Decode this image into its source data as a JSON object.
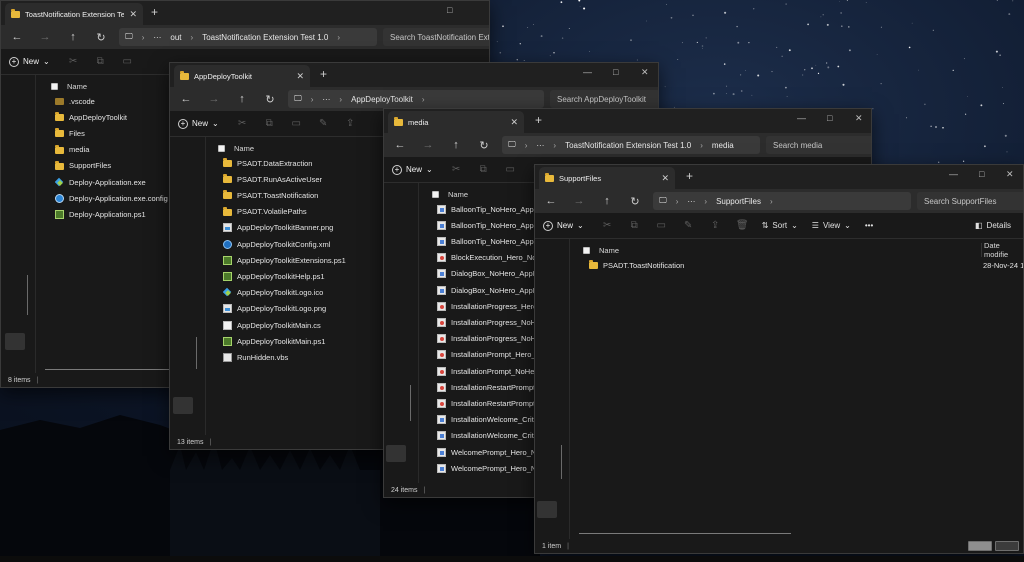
{
  "windows": {
    "w1": {
      "tab_title": "ToastNotification Extension Te",
      "breadcrumb": [
        "out",
        "ToastNotification Extension Test 1.0"
      ],
      "search_placeholder": "Search ToastNotification Ext",
      "new_label": "New",
      "column_name": "Name",
      "items": [
        {
          "name": ".vscode",
          "icon": "vscode-folder-icon"
        },
        {
          "name": "AppDeployToolkit",
          "icon": "folder-icon"
        },
        {
          "name": "Files",
          "icon": "folder-icon"
        },
        {
          "name": "media",
          "icon": "folder-icon"
        },
        {
          "name": "SupportFiles",
          "icon": "folder-icon"
        },
        {
          "name": "Deploy-Application.exe",
          "icon": "exe-icon"
        },
        {
          "name": "Deploy-Application.exe.config",
          "icon": "config-icon"
        },
        {
          "name": "Deploy-Application.ps1",
          "icon": "powershell-script-icon"
        }
      ],
      "status_text": "8 items"
    },
    "w2": {
      "tab_title": "AppDeployToolkit",
      "breadcrumb": [
        "AppDeployToolkit"
      ],
      "search_placeholder": "Search AppDeployToolkit",
      "new_label": "New",
      "column_name": "Name",
      "items": [
        {
          "name": "PSADT.DataExtraction",
          "icon": "folder-icon"
        },
        {
          "name": "PSADT.RunAsActiveUser",
          "icon": "folder-icon"
        },
        {
          "name": "PSADT.ToastNotification",
          "icon": "folder-icon"
        },
        {
          "name": "PSADT.VolatilePaths",
          "icon": "folder-icon"
        },
        {
          "name": "AppDeployToolkitBanner.png",
          "icon": "png-image-icon"
        },
        {
          "name": "AppDeployToolkitConfig.xml",
          "icon": "xml-file-icon"
        },
        {
          "name": "AppDeployToolkitExtensions.ps1",
          "icon": "powershell-script-icon"
        },
        {
          "name": "AppDeployToolkitHelp.ps1",
          "icon": "powershell-script-icon"
        },
        {
          "name": "AppDeployToolkitLogo.ico",
          "icon": "ico-file-icon"
        },
        {
          "name": "AppDeployToolkitLogo.png",
          "icon": "png-image-icon"
        },
        {
          "name": "AppDeployToolkitMain.cs",
          "icon": "csharp-file-icon"
        },
        {
          "name": "AppDeployToolkitMain.ps1",
          "icon": "powershell-script-icon"
        },
        {
          "name": "RunHidden.vbs",
          "icon": "vbs-script-icon"
        }
      ],
      "status_text": "13 items"
    },
    "w3": {
      "tab_title": "media",
      "breadcrumb": [
        "ToastNotification Extension Test 1.0",
        "media"
      ],
      "search_placeholder": "Search media",
      "new_label": "New",
      "column_name": "Name",
      "items": [
        {
          "name": "BalloonTip_NoHero_AppLog",
          "icon": "image-file-icon"
        },
        {
          "name": "BalloonTip_NoHero_AppLog",
          "icon": "image-file-icon"
        },
        {
          "name": "BalloonTip_NoHero_AppLog",
          "icon": "image-file-icon"
        },
        {
          "name": "BlockExecution_Hero_NoAp",
          "icon": "image-file-red-icon"
        },
        {
          "name": "DialogBox_NoHero_AppLog",
          "icon": "image-file-icon"
        },
        {
          "name": "DialogBox_NoHero_AppLog",
          "icon": "image-file-icon"
        },
        {
          "name": "InstallationProgress_Hero_Ap",
          "icon": "image-file-red-icon"
        },
        {
          "name": "InstallationProgress_NoHero",
          "icon": "image-file-red-icon"
        },
        {
          "name": "InstallationProgress_NoHero",
          "icon": "image-file-red-icon"
        },
        {
          "name": "InstallationPrompt_Hero_Ap",
          "icon": "image-file-red-icon"
        },
        {
          "name": "InstallationPrompt_NoHero_",
          "icon": "image-file-red-icon"
        },
        {
          "name": "InstallationRestartPrompt_H",
          "icon": "image-file-red-icon"
        },
        {
          "name": "InstallationRestartPrompt_N",
          "icon": "image-file-red-icon"
        },
        {
          "name": "InstallationWelcome_Critical",
          "icon": "image-file-icon"
        },
        {
          "name": "InstallationWelcome_Critical",
          "icon": "image-file-icon"
        },
        {
          "name": "WelcomePrompt_Hero_NoA",
          "icon": "image-file-icon"
        },
        {
          "name": "WelcomePrompt_Hero_NoA",
          "icon": "image-file-icon"
        }
      ],
      "status_text": "24 items"
    },
    "w4": {
      "tab_title": "SupportFiles",
      "breadcrumb": [
        "SupportFiles"
      ],
      "search_placeholder": "Search SupportFiles",
      "new_label": "New",
      "sort_label": "Sort",
      "view_label": "View",
      "details_label": "Details",
      "column_name": "Name",
      "column_date": "Date modifie",
      "items": [
        {
          "name": "PSADT.ToastNotification",
          "icon": "folder-icon",
          "date": "28-Nov-24 16"
        }
      ],
      "status_text": "1 item"
    }
  },
  "glyphs": {
    "back": "←",
    "forward": "→",
    "up": "↑",
    "refresh": "↻",
    "ellipsis": "···",
    "chevron": "›",
    "close": "✕",
    "plus": "+",
    "minimize": "—",
    "maximize": "□",
    "caret": "⌄",
    "more": "•••",
    "monitor": "🖵"
  }
}
